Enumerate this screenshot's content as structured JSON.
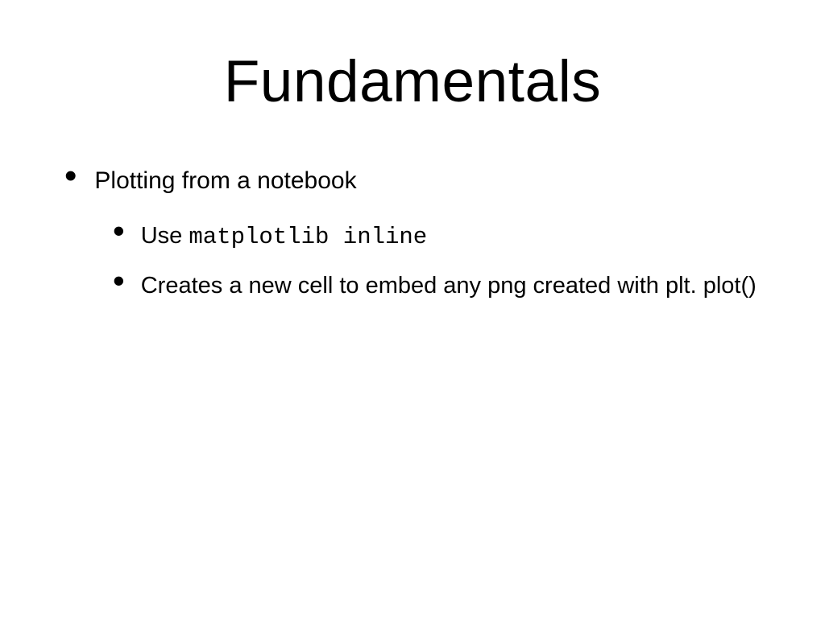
{
  "title": "Fundamentals",
  "bullets": {
    "item1": "Plotting from a notebook",
    "sub1_prefix": "Use ",
    "sub1_code": "matplotlib inline",
    "sub2": "Creates a new cell to embed any png created with plt. plot()"
  }
}
